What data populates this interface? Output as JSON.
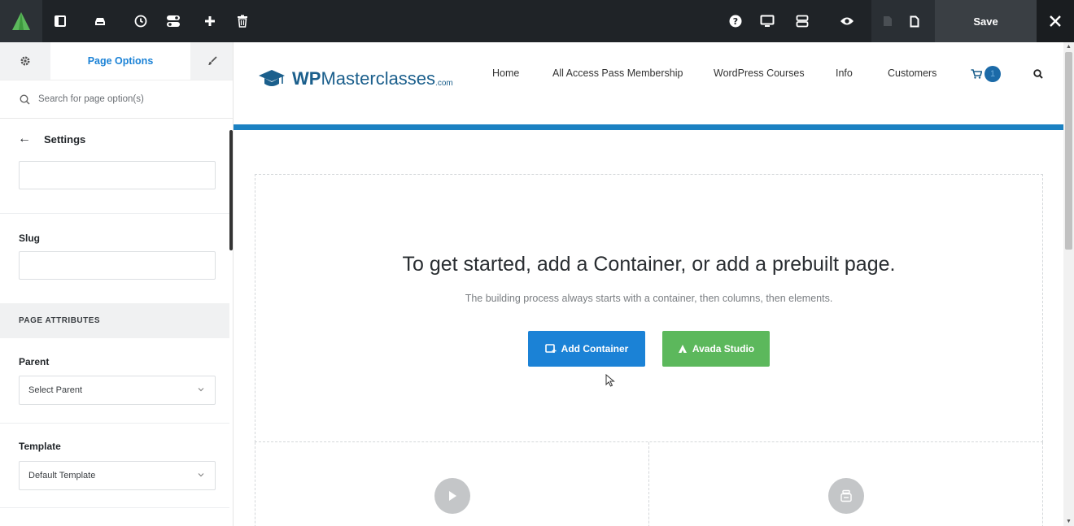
{
  "toolbar": {
    "save_label": "Save",
    "buttons": [
      "sidebar-toggle-icon",
      "library-icon",
      "history-icon",
      "toggles-icon",
      "plus-icon",
      "trash-icon",
      "help-icon",
      "desktop-icon",
      "layout-icon",
      "eye-icon",
      "page-icon",
      "document-icon",
      "close-icon"
    ]
  },
  "sidebar": {
    "tab_label": "Page Options",
    "search_placeholder": "Search for page option(s)",
    "back_label": "Settings",
    "slug_label": "Slug",
    "section_title": "PAGE ATTRIBUTES",
    "parent_label": "Parent",
    "parent_value": "Select Parent",
    "template_label": "Template",
    "template_value": "Default Template"
  },
  "site": {
    "brand_wp": "WP",
    "brand_rest": "Masterclasses",
    "brand_com": ".com",
    "nav": [
      "Home",
      "All Access Pass Membership",
      "WordPress Courses",
      "Info",
      "Customers"
    ],
    "cart_count": "1"
  },
  "builder": {
    "title": "To get started, add a Container, or add a prebuilt page.",
    "subtitle": "The building process always starts with a container, then columns, then elements.",
    "add_container_label": "Add Container",
    "studio_label": "Avada Studio"
  },
  "colors": {
    "toolbar_bg": "#1f2327",
    "accent_blue": "#1b82d6",
    "studio_green": "#5cb85c",
    "brand_blue": "#1b5f8c",
    "header_bar": "#1b81c2"
  }
}
